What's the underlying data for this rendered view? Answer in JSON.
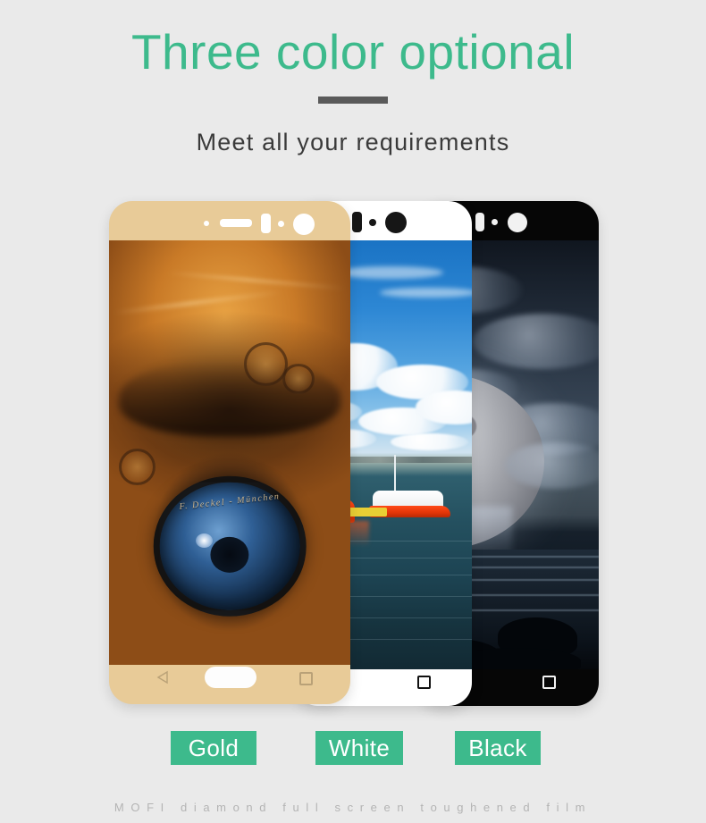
{
  "page": {
    "background_color": "#eaeaea",
    "accent_color": "#3dba8c",
    "divider_color": "#5a5a5a"
  },
  "header": {
    "headline": "Three color optional",
    "subtitle": "Meet all your requirements"
  },
  "phones": [
    {
      "color_name": "Gold",
      "bezel_color": "#e8cb98",
      "hardware_color": "#ffffff",
      "wallpaper": "steampunk-eye-camera-lens",
      "lens_engraving": "F. Deckel - München",
      "layer": "front"
    },
    {
      "color_name": "White",
      "bezel_color": "#ffffff",
      "hardware_color": "#111111",
      "wallpaper": "harbour-boats-blue-sky",
      "layer": "middle"
    },
    {
      "color_name": "Black",
      "bezel_color": "#060606",
      "hardware_color": "#f2f2f2",
      "wallpaper": "full-moon-over-ocean",
      "layer": "back"
    }
  ],
  "badges": [
    {
      "label": "Gold"
    },
    {
      "label": "White"
    },
    {
      "label": "Black"
    }
  ],
  "footer": {
    "tagline": "MOFI diamond full screen toughened film"
  }
}
